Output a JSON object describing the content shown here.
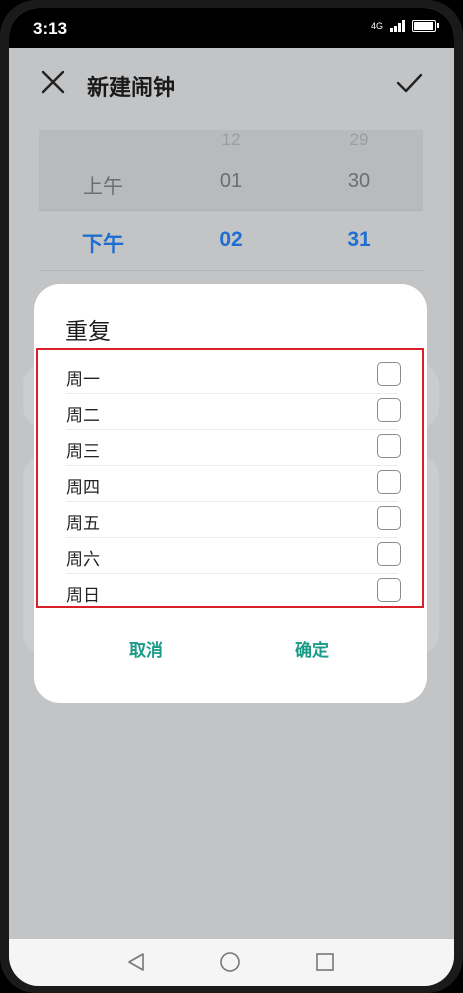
{
  "status_bar": {
    "time": "3:13",
    "network_label": "4G"
  },
  "app_bar": {
    "title": "新建闹钟"
  },
  "time_picker": {
    "period": {
      "faded": "",
      "mid": "上午",
      "selected": "下午"
    },
    "hour": {
      "faded": "12",
      "mid": "01",
      "selected": "02"
    },
    "minute": {
      "faded": "29",
      "mid": "30",
      "selected": "31"
    }
  },
  "repeat_dialog": {
    "title": "重复",
    "days": [
      {
        "label": "周一",
        "checked": false
      },
      {
        "label": "周二",
        "checked": false
      },
      {
        "label": "周三",
        "checked": false
      },
      {
        "label": "周四",
        "checked": false
      },
      {
        "label": "周五",
        "checked": false
      },
      {
        "label": "周六",
        "checked": false
      },
      {
        "label": "周日",
        "checked": false
      }
    ],
    "cancel_label": "取消",
    "confirm_label": "确定"
  },
  "colors": {
    "accent_selected": "#1f6fd1",
    "dialog_button": "#1a9b86",
    "highlight_border": "#d7202c"
  },
  "icons": [
    "close-icon",
    "check-icon",
    "back-icon",
    "home-icon",
    "recents-icon",
    "battery-icon",
    "signal-icon"
  ]
}
